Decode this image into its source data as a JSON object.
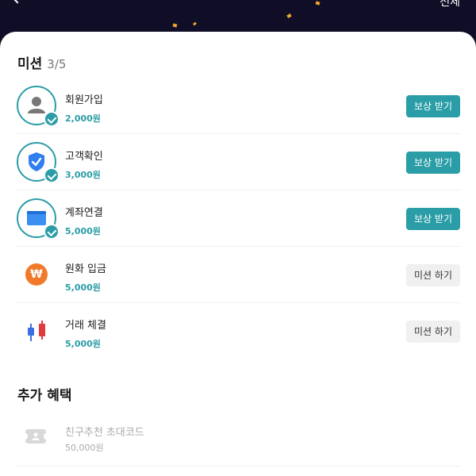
{
  "header": {
    "top_right_label": "전체"
  },
  "missions_section": {
    "title": "미션",
    "progress": "3/5"
  },
  "missions": [
    {
      "title": "회원가입",
      "reward": "2,000원",
      "button": "보상 받기",
      "completed": true,
      "icon": "user-icon"
    },
    {
      "title": "고객확인",
      "reward": "3,000원",
      "button": "보상 받기",
      "completed": true,
      "icon": "shield-check-icon"
    },
    {
      "title": "계좌연결",
      "reward": "5,000원",
      "button": "보상 받기",
      "completed": true,
      "icon": "bank-card-icon"
    },
    {
      "title": "원화 입금",
      "reward": "5,000원",
      "button": "미션 하기",
      "completed": false,
      "icon": "won-coin-icon",
      "icon_glyph": "₩"
    },
    {
      "title": "거래 체결",
      "reward": "5,000원",
      "button": "미션 하기",
      "completed": false,
      "icon": "candlestick-icon"
    }
  ],
  "extra_section": {
    "title": "추가 혜택",
    "items": [
      {
        "title": "친구추천 초대코드",
        "reward": "50,000원",
        "icon": "ticket-icon"
      }
    ]
  },
  "colors": {
    "accent": "#2a9da6",
    "header_bg": "#0f0e26",
    "won_coin": "#f07a2a",
    "shield": "#2f7ff0",
    "candle_blue": "#3a6fe0",
    "candle_red": "#e03a3a"
  }
}
